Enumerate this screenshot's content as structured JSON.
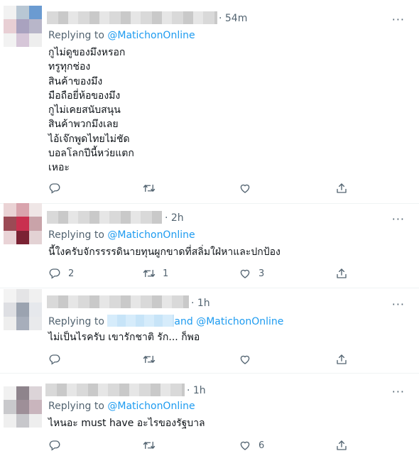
{
  "tweets": [
    {
      "time": "· 54m",
      "more": "···",
      "reply_prefix": "Replying to ",
      "reply_handle": "@MatichonOnline",
      "text": "กูไม่ดูของมึงหรอก\nทรูทุกช่อง\nสินค้าของมึง\nมือถือยี่ห้อของมึง\nกูไม่เคยสนับสนุน\nสินค้าพวกมึงเลย\nไอ้เจ๊กพูดไทยไม่ชัด\nบอลโลกปีนี้หว่ยแตก\nเหอะ",
      "counts": {
        "reply": "",
        "retweet": "",
        "like": ""
      },
      "avatar_colors": [
        "#f2f2f2",
        "#b8c7d4",
        "#6b9bd1",
        "#e8cfd4",
        "#a9a2bf",
        "#b8b6c9",
        "#f2f2f2",
        "#d6c6d8",
        "#eeeeee"
      ]
    },
    {
      "time": "· 2h",
      "more": "···",
      "reply_prefix": "Replying to ",
      "reply_handle": "@MatichonOnline",
      "text": "นี้ใงครับจักรรรรดินายทุนผูกขาดที่สลิ่มใฝ่หาและปกป้อง",
      "counts": {
        "reply": "2",
        "retweet": "1",
        "like": "3"
      },
      "avatar_colors": [
        "#ead3d5",
        "#d9a4ad",
        "#efe6e6",
        "#9b4a55",
        "#c9304f",
        "#c9a3a9",
        "#e9d3d6",
        "#7a2233",
        "#e3d2d4"
      ]
    },
    {
      "time": "· 1h",
      "more": "···",
      "reply_prefix": "Replying to ",
      "reply_mid": "and ",
      "reply_handle": "@MatichonOnline",
      "text": "ไม่เป็นไรครับ เขารักชาติ รัก... ก็พอ",
      "counts": {
        "reply": "",
        "retweet": "",
        "like": ""
      },
      "avatar_colors": [
        "#f3f3f3",
        "#e4e4e6",
        "#f0f0f0",
        "#dedfe3",
        "#9ba3b0",
        "#e6e8ec",
        "#eeeeee",
        "#a7aebb",
        "#e9eaec"
      ]
    },
    {
      "time": "· 1h",
      "more": "···",
      "reply_prefix": "Replying to ",
      "reply_handle": "@MatichonOnline",
      "text": "ไหนอะ must have อะไรของรัฐบาล",
      "counts": {
        "reply": "",
        "retweet": "",
        "like": "6"
      },
      "avatar_colors": [
        "#f1f1f1",
        "#8e848c",
        "#dcd4d8",
        "#c9c9cc",
        "#9e8f98",
        "#c9b5bd",
        "#efefef",
        "#c7c7cb",
        "#eeeeee"
      ]
    }
  ],
  "icons": {
    "reply": "reply-icon",
    "retweet": "retweet-icon",
    "like": "heart-icon",
    "share": "share-icon",
    "more": "more-icon"
  },
  "colors": {
    "link": "#1d9bf0",
    "muted": "#536471",
    "text": "#0f1419",
    "divider": "#eff3f4"
  }
}
